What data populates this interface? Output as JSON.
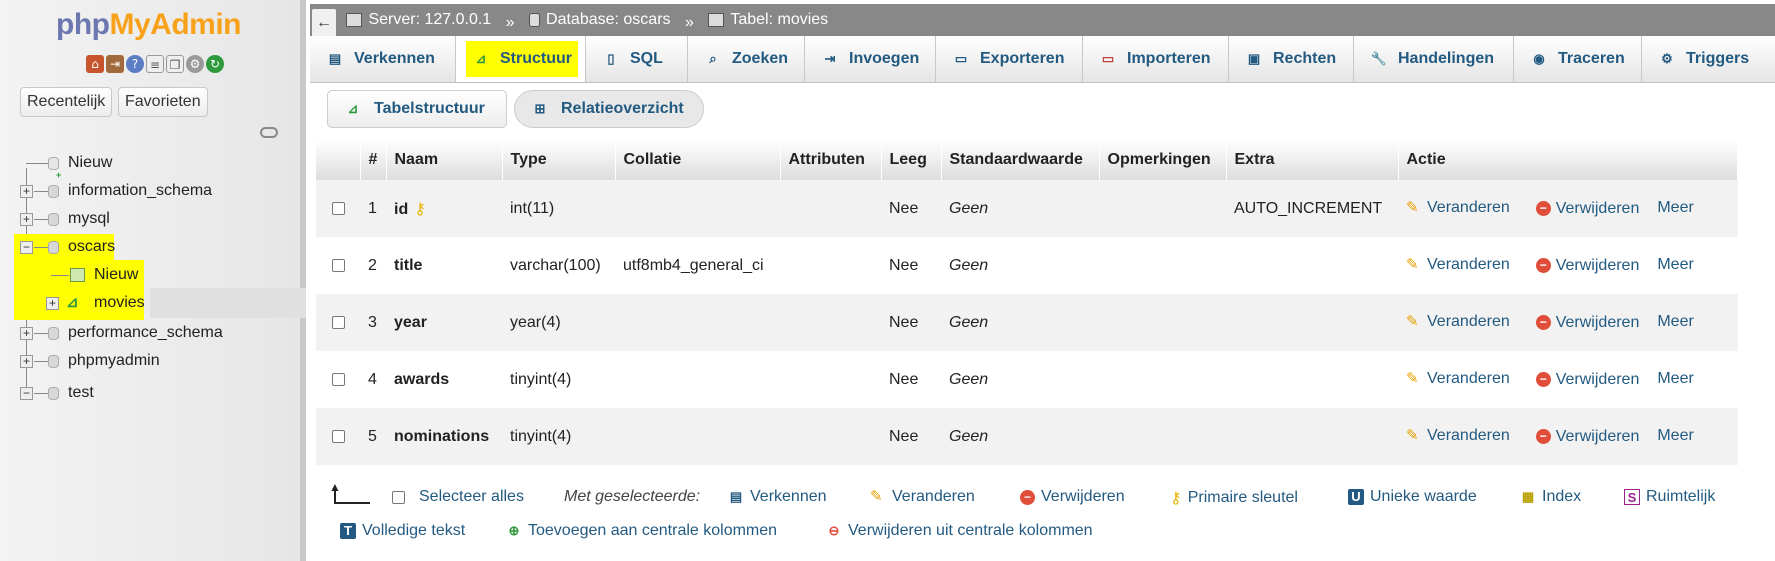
{
  "logo": {
    "part1": "php",
    "part2": "MyAdmin"
  },
  "left": {
    "recent_label": "Recentelijk",
    "favorites_label": "Favorieten",
    "tree": [
      {
        "label": "Nieuw"
      },
      {
        "label": "information_schema"
      },
      {
        "label": "mysql"
      },
      {
        "label": "oscars"
      },
      {
        "label": "Nieuw"
      },
      {
        "label": "movies"
      },
      {
        "label": "performance_schema"
      },
      {
        "label": "phpmyadmin"
      },
      {
        "label": "test"
      }
    ]
  },
  "breadcrumb": {
    "server": "Server: 127.0.0.1",
    "sep": "»",
    "database": "Database: oscars",
    "table": "Tabel: movies",
    "back": "←"
  },
  "tabs": [
    "Verkennen",
    "Structuur",
    "SQL",
    "Zoeken",
    "Invoegen",
    "Exporteren",
    "Importeren",
    "Rechten",
    "Handelingen",
    "Traceren",
    "Triggers"
  ],
  "subtabs": {
    "structure": "Tabelstructuur",
    "relation": "Relatieoverzicht"
  },
  "table": {
    "headers": [
      "#",
      "Naam",
      "Type",
      "Collatie",
      "Attributen",
      "Leeg",
      "Standaardwaarde",
      "Opmerkingen",
      "Extra",
      "Actie"
    ],
    "action_labels": {
      "change": "Veranderen",
      "drop": "Verwijderen",
      "more": "Meer"
    },
    "rows": [
      {
        "num": "1",
        "name": "id",
        "type": "int(11)",
        "collation": "",
        "attributes": "",
        "null": "Nee",
        "default": "Geen",
        "comments": "",
        "extra": "AUTO_INCREMENT"
      },
      {
        "num": "2",
        "name": "title",
        "type": "varchar(100)",
        "collation": "utf8mb4_general_ci",
        "attributes": "",
        "null": "Nee",
        "default": "Geen",
        "comments": "",
        "extra": ""
      },
      {
        "num": "3",
        "name": "year",
        "type": "year(4)",
        "collation": "",
        "attributes": "",
        "null": "Nee",
        "default": "Geen",
        "comments": "",
        "extra": ""
      },
      {
        "num": "4",
        "name": "awards",
        "type": "tinyint(4)",
        "collation": "",
        "attributes": "",
        "null": "Nee",
        "default": "Geen",
        "comments": "",
        "extra": ""
      },
      {
        "num": "5",
        "name": "nominations",
        "type": "tinyint(4)",
        "collation": "",
        "attributes": "",
        "null": "Nee",
        "default": "Geen",
        "comments": "",
        "extra": ""
      }
    ]
  },
  "bulk": {
    "select_all": "Selecteer alles",
    "with_selected": "Met geselecteerde:",
    "browse": "Verkennen",
    "change": "Veranderen",
    "drop": "Verwijderen",
    "primary": "Primaire sleutel",
    "unique": "Unieke waarde",
    "index": "Index",
    "spatial": "Ruimtelijk",
    "fulltext": "Volledige tekst",
    "add_central": "Toevoegen aan centrale kolommen",
    "remove_central": "Verwijderen uit centrale kolommen"
  }
}
